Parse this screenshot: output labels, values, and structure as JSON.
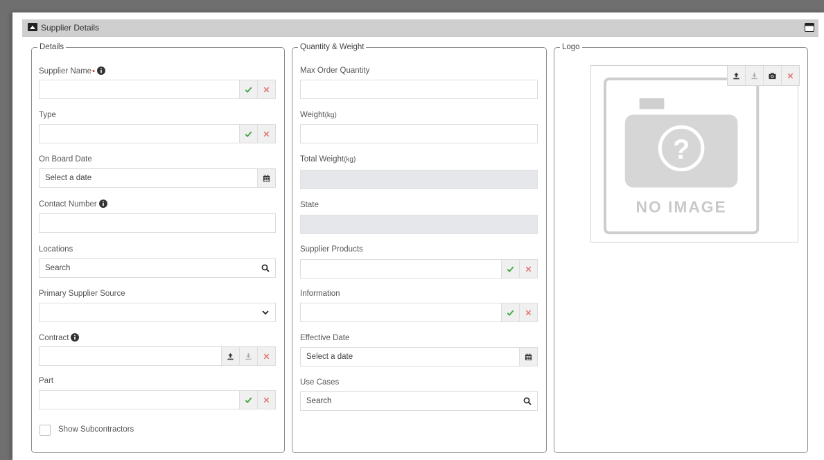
{
  "panel": {
    "title": "Supplier Details"
  },
  "details": {
    "legend": "Details",
    "supplier_name": {
      "label": "Supplier Name",
      "required_mark": "•",
      "value": ""
    },
    "type": {
      "label": "Type",
      "value": ""
    },
    "on_board_date": {
      "label": "On Board Date",
      "placeholder": "Select a date"
    },
    "contact_number": {
      "label": "Contact Number",
      "value": ""
    },
    "locations": {
      "label": "Locations",
      "placeholder": "Search"
    },
    "primary_supplier_source": {
      "label": "Primary Supplier Source",
      "selected": ""
    },
    "contract": {
      "label": "Contract",
      "value": ""
    },
    "part": {
      "label": "Part",
      "value": ""
    },
    "show_subcontractors": {
      "label": "Show Subcontractors",
      "checked": false
    }
  },
  "quantity_weight": {
    "legend": "Quantity & Weight",
    "max_order_quantity": {
      "label": "Max Order Quantity",
      "value": ""
    },
    "weight": {
      "label": "Weight",
      "unit": "(kg)",
      "value": ""
    },
    "total_weight": {
      "label": "Total Weight",
      "unit": "(kg)",
      "value": ""
    },
    "state": {
      "label": "State",
      "value": ""
    },
    "supplier_products": {
      "label": "Supplier Products",
      "value": ""
    },
    "information": {
      "label": "Information",
      "value": ""
    },
    "effective_date": {
      "label": "Effective Date",
      "placeholder": "Select a date"
    },
    "use_cases": {
      "label": "Use Cases",
      "placeholder": "Search"
    }
  },
  "logo": {
    "legend": "Logo",
    "no_image_text": "NO IMAGE"
  },
  "icons": {
    "header": "panel-icon",
    "maximize": "maximize-icon",
    "info": "info-icon",
    "confirm": "check-icon",
    "clear": "x-icon",
    "calendar": "calendar-icon",
    "search": "search-icon",
    "dropdown": "chevron-down-icon",
    "upload": "upload-icon",
    "download": "download-icon",
    "camera": "camera-icon"
  },
  "colors": {
    "confirm": "#3aa53a",
    "clear": "#e36a6a",
    "header_bg": "#cfcfcf",
    "disabled_bg": "#e6e7ea",
    "required": "#e0232f"
  }
}
